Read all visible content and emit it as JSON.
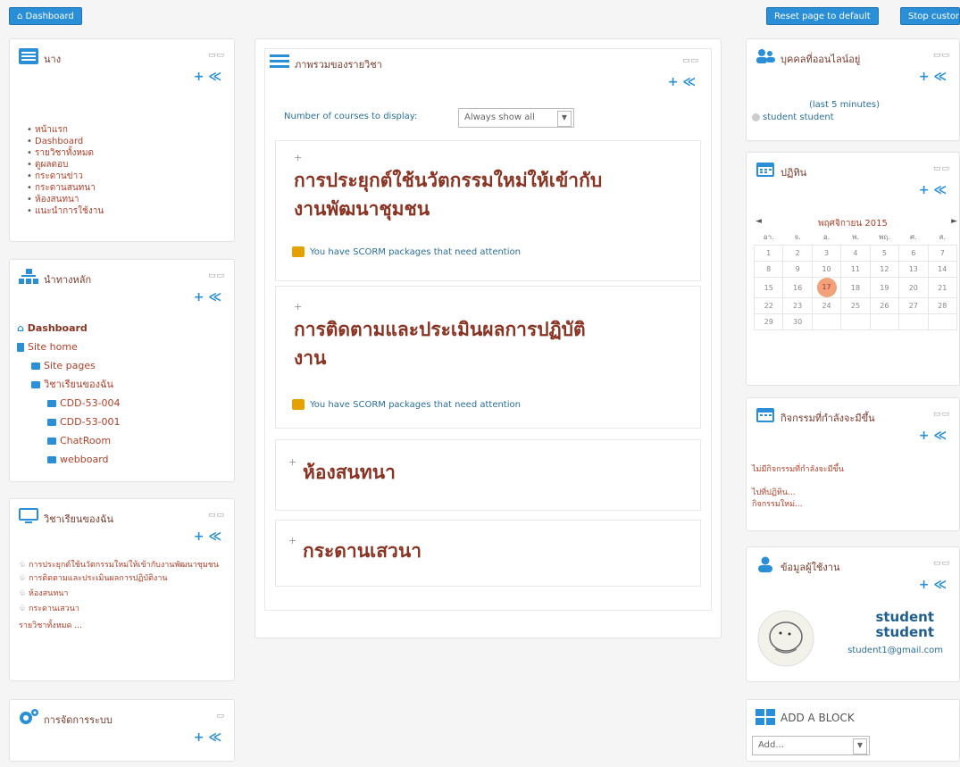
{
  "topbar": {
    "dashboard": "Dashboard",
    "reset": "Reset page to default",
    "customise": "Stop customising this page"
  },
  "nav_block": {
    "title": "นาง",
    "items": [
      "หน้าแรก",
      "Dashboard",
      "รายวิชาทั้งหมด",
      "ดูผลตอบ",
      "กระดานข่าว",
      "กระดานสนทนา",
      "ห้องสนทนา",
      "แนะนำการใช้งาน"
    ]
  },
  "main_block": {
    "title": "นำทางหลัก",
    "tree": [
      {
        "label": "Dashboard",
        "level": 0,
        "bold": true
      },
      {
        "label": "Site home",
        "level": 0
      },
      {
        "label": "Site pages",
        "level": 1
      },
      {
        "label": "วิชาเรียนของฉัน",
        "level": 1
      },
      {
        "label": "CDD-53-004",
        "level": 2
      },
      {
        "label": "CDD-53-001",
        "level": 2
      },
      {
        "label": "ChatRoom",
        "level": 2
      },
      {
        "label": "webboard",
        "level": 2
      }
    ]
  },
  "mycourses_block": {
    "title": "วิชาเรียนของฉัน",
    "items": [
      "การประยุกต์ใช้นวัตกรรมใหม่ให้เข้ากับงานพัฒนาชุมชน",
      "การติดตามและประเมินผลการปฏิบัติงาน",
      "ห้องสนทนา",
      "กระดานเสวนา"
    ],
    "all": "รายวิชาทั้งหมด ..."
  },
  "admin_block": {
    "title": "การจัดการระบบ"
  },
  "overview": {
    "title": "ภาพรวมของรายวิชา",
    "count_label": "Number of courses to display:",
    "count_value": "Always show all",
    "courses": [
      {
        "title1": "การประยุกต์ใช้นวัตกรรมใหม่ให้เข้ากับ",
        "title2": "งานพัฒนาชุมชน",
        "note": "You have SCORM packages that need attention"
      },
      {
        "title1": "การติดตามและประเมินผลการปฏิบัติ",
        "title2": "งาน",
        "note": "You have SCORM packages that need attention"
      },
      {
        "title1": "ห้องสนทนา"
      },
      {
        "title1": "กระดานเสวนา"
      }
    ]
  },
  "online_block": {
    "title": "บุคคลที่ออนไลน์อยู่",
    "period": "(last 5 minutes)",
    "user": "student student"
  },
  "calendar_block": {
    "title": "ปฏิทิน",
    "month": "พฤศจิกายน 2015",
    "days": [
      "อา.",
      "จ.",
      "อ.",
      "พ.",
      "พฤ.",
      "ศ.",
      "ส."
    ],
    "weeks": [
      [
        "1",
        "2",
        "3",
        "4",
        "5",
        "6",
        "7"
      ],
      [
        "8",
        "9",
        "10",
        "11",
        "12",
        "13",
        "14"
      ],
      [
        "15",
        "16",
        "17",
        "18",
        "19",
        "20",
        "21"
      ],
      [
        "22",
        "23",
        "24",
        "25",
        "26",
        "27",
        "28"
      ],
      [
        "29",
        "30",
        "",
        "",
        "",
        "",
        ""
      ]
    ],
    "today": "17"
  },
  "events_block": {
    "title": "กิจกรรมที่กำลังจะมีขึ้น",
    "none": "ไม่มีกิจกรรมที่กำลังจะมีขึ้น",
    "link1": "ไปที่ปฏิทิน...",
    "link2": "กิจกรรมใหม่..."
  },
  "user_block": {
    "title": "ข้อมูลผู้ใช้งาน",
    "name1": "student",
    "name2": "student",
    "email": "student1@gmail.com"
  },
  "addblock": {
    "title": "ADD A BLOCK",
    "select": "Add..."
  },
  "colors": {
    "accent": "#2a8fd6",
    "title": "#8a3322",
    "link": "#b0402a"
  }
}
